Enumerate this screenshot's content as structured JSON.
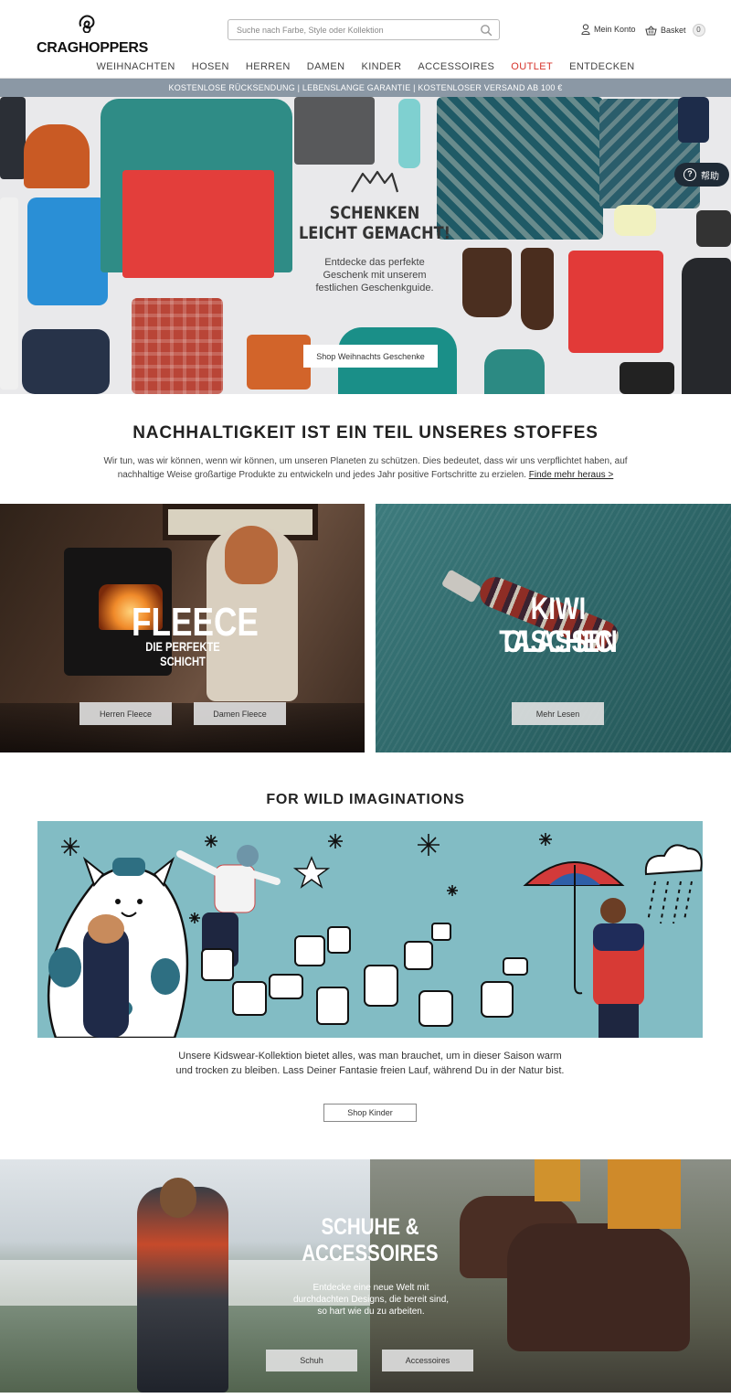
{
  "header": {
    "logo_text": "CRAGHOPPERS",
    "search_placeholder": "Suche nach Farbe, Style oder Kollektion",
    "account_label": "Mein Konto",
    "basket_label": "Basket",
    "basket_count": "0"
  },
  "nav": {
    "items": [
      "WEIHNACHTEN",
      "HOSEN",
      "HERREN",
      "DAMEN",
      "KINDER",
      "ACCESSOIRES",
      "OUTLET",
      "ENTDECKEN"
    ],
    "outlet_color": "#d6332b"
  },
  "promo": {
    "text": "KOSTENLOSE RÜCKSENDUNG | LEBENSLANGE GARANTIE | KOSTENLOSER VERSAND AB 100 €"
  },
  "hero": {
    "title_line1": "SCHENKEN",
    "title_line2": "LEICHT GEMACHT!",
    "subtitle_line1": "Entdecke das perfekte",
    "subtitle_line2": "Geschenk mit unserem",
    "subtitle_line3": "festlichen Geschenkguide.",
    "button": "Shop Weihnachts Geschenke"
  },
  "help_chip": {
    "label": "帮助"
  },
  "sustainability": {
    "title": "NACHHALTIGKEIT IST EIN TEIL UNSERES STOFFES",
    "text": "Wir tun, was wir können, wenn wir können, um unseren Planeten zu schützen. Dies bedeutet, dass wir uns verpflichtet haben, auf nachhaltige Weise großartige Produkte zu entwickeln und jedes Jahr positive Fortschritte zu erzielen.",
    "link": "Finde mehr heraus >"
  },
  "fleece": {
    "title": "FLEECE",
    "subtitle": "DIE PERFEKTE SCHICHT",
    "btn_men": "Herren Fleece",
    "btn_women": "Damen Fleece"
  },
  "kiwi": {
    "title_line1": "KIWI CLASSIC",
    "title_line2": "TASCHEN",
    "button": "Mehr Lesen"
  },
  "kids": {
    "title": "FOR WILD IMAGINATIONS",
    "text": "Unsere Kidswear-Kollektion bietet alles, was man brauchet, um in dieser Saison warm und trocken zu bleiben. Lass Deiner Fantasie freien Lauf, während Du in der Natur bist.",
    "button": "Shop Kinder"
  },
  "shoes": {
    "title_line1": "SCHUHE &",
    "title_line2": "ACCESSOIRES",
    "text": "Entdecke eine neue Welt mit durchdachten Designs, die bereit sind, so hart wie du zu arbeiten.",
    "btn_shoes": "Schuh",
    "btn_accessories": "Accessoires"
  }
}
